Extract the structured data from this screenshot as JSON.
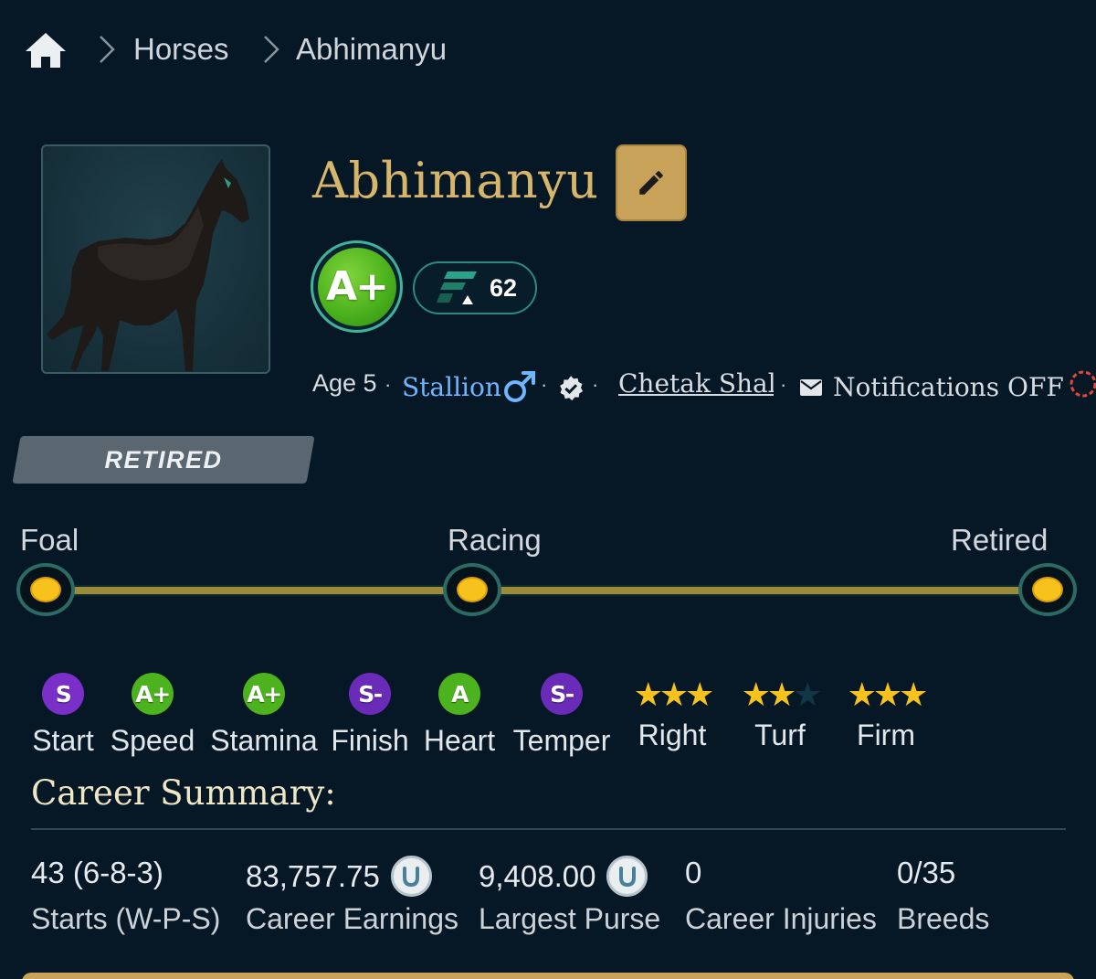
{
  "breadcrumb": {
    "items": [
      "Horses",
      "Abhimanyu"
    ]
  },
  "horse": {
    "name": "Abhimanyu",
    "grade": "A+",
    "rating": "62",
    "age": "Age 5",
    "sex": "Stallion",
    "owner": "Chetak Shala",
    "notifications": "Notifications OFF",
    "status": "RETIRED"
  },
  "timeline": {
    "stages": [
      "Foal",
      "Racing",
      "Retired"
    ]
  },
  "attributes": [
    {
      "label": "Start",
      "grade": "S",
      "color": "#7a2fc8"
    },
    {
      "label": "Speed",
      "grade": "A+",
      "color": "#4cb21d"
    },
    {
      "label": "Stamina",
      "grade": "A+",
      "color": "#4cb21d"
    },
    {
      "label": "Finish",
      "grade": "S-",
      "color": "#6a2bb8"
    },
    {
      "label": "Heart",
      "grade": "A",
      "color": "#4cb21d"
    },
    {
      "label": "Temper",
      "grade": "S-",
      "color": "#6a2bb8"
    }
  ],
  "preferences": [
    {
      "label": "Right",
      "stars": 3,
      "max": 3
    },
    {
      "label": "Turf",
      "stars": 2,
      "max": 3
    },
    {
      "label": "Firm",
      "stars": 3,
      "max": 3
    }
  ],
  "career": {
    "title": "Career Summary:",
    "stats": [
      {
        "value": "43 (6-8-3)",
        "label": "Starts (W-P-S)",
        "coin": false
      },
      {
        "value": "83,757.75",
        "label": "Career Earnings",
        "coin": true
      },
      {
        "value": "9,408.00",
        "label": "Largest Purse",
        "coin": true
      },
      {
        "value": "0",
        "label": "Career Injuries",
        "coin": false
      },
      {
        "value": "0/35",
        "label": "Breeds",
        "coin": false
      }
    ]
  },
  "colors": {
    "background": "#061826",
    "gold": "#d7b56b",
    "star": "#f7c21b",
    "link": "#6fb6ff"
  }
}
